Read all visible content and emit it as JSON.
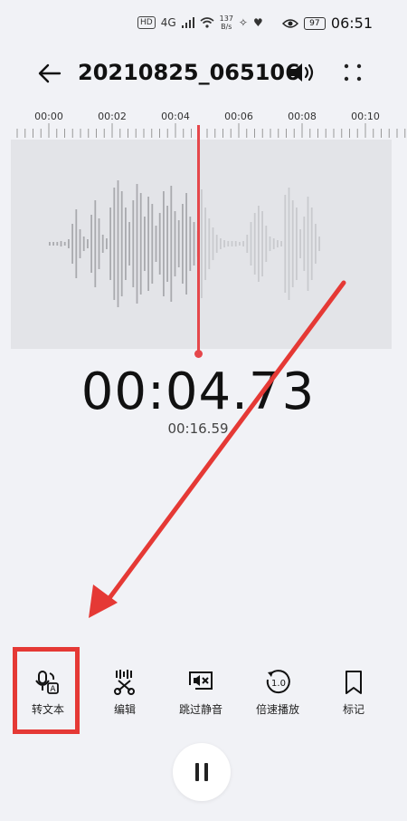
{
  "status": {
    "network": "4G",
    "speed_value": "137",
    "speed_unit": "B/s",
    "battery": "97",
    "time": "06:51"
  },
  "header": {
    "title": "20210825_065106"
  },
  "ruler": {
    "labels": [
      "00:00",
      "00:02",
      "00:04",
      "00:06",
      "00:08",
      "00:10"
    ]
  },
  "player": {
    "current_time": "00:04.73",
    "total_time": "00:16.59"
  },
  "toolbar": {
    "items": [
      {
        "label": "转文本",
        "icon": "speech-to-text-icon"
      },
      {
        "label": "编辑",
        "icon": "edit-scissors-icon"
      },
      {
        "label": "跳过静音",
        "icon": "skip-silence-icon"
      },
      {
        "label": "倍速播放",
        "icon": "playback-speed-icon",
        "badge": "1.0"
      },
      {
        "label": "标记",
        "icon": "bookmark-icon"
      }
    ]
  },
  "colors": {
    "accent": "#e5474b",
    "highlight": "#e53935",
    "background": "#f1f2f6"
  }
}
